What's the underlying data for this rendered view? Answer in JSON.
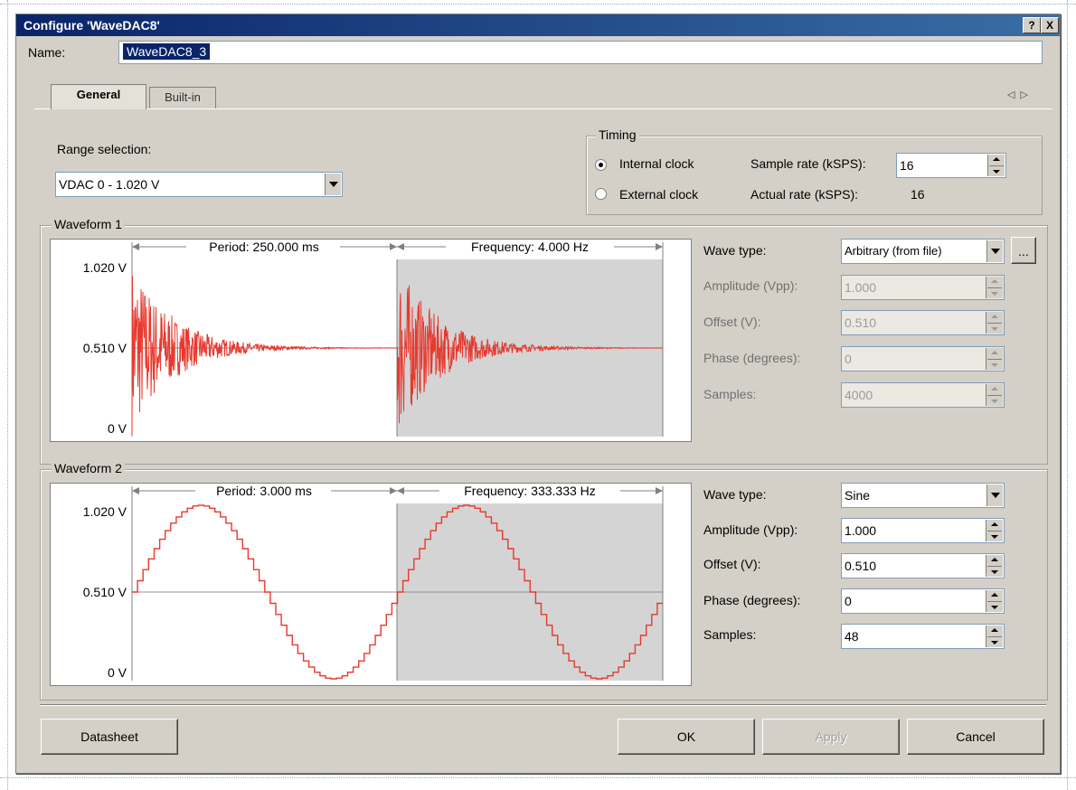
{
  "window": {
    "title": "Configure 'WaveDAC8'",
    "help_btn": "?",
    "close_btn": "X"
  },
  "name": {
    "label": "Name:",
    "value": "WaveDAC8_3"
  },
  "tabs": [
    {
      "label": "General"
    },
    {
      "label": "Built-in"
    }
  ],
  "range": {
    "label": "Range selection:",
    "value": "VDAC 0 - 1.020 V"
  },
  "timing": {
    "title": "Timing",
    "internal_label": "Internal clock",
    "external_label": "External clock",
    "internal_selected": true,
    "sample_rate_label": "Sample rate (kSPS):",
    "sample_rate_value": "16",
    "actual_rate_label": "Actual rate (kSPS):",
    "actual_rate_value": "16"
  },
  "waveform1": {
    "title": "Waveform 1",
    "period_label": "Period: 250.000 ms",
    "frequency_label": "Frequency: 4.000 Hz",
    "y_ticks": [
      "1.020 V",
      "0.510 V",
      "0 V"
    ],
    "wave_type_label": "Wave type:",
    "wave_type_value": "Arbitrary (from file)",
    "browse_label": "...",
    "amplitude_label": "Amplitude (Vpp):",
    "amplitude_value": "1.000",
    "offset_label": "Offset (V):",
    "offset_value": "0.510",
    "phase_label": "Phase (degrees):",
    "phase_value": "0",
    "samples_label": "Samples:",
    "samples_value": "4000",
    "wave_color": "#e8392f"
  },
  "waveform2": {
    "title": "Waveform 2",
    "period_label": "Period: 3.000 ms",
    "frequency_label": "Frequency: 333.333 Hz",
    "y_ticks": [
      "1.020 V",
      "0.510 V",
      "0 V"
    ],
    "wave_type_label": "Wave type:",
    "wave_type_value": "Sine",
    "amplitude_label": "Amplitude (Vpp):",
    "amplitude_value": "1.000",
    "offset_label": "Offset (V):",
    "offset_value": "0.510",
    "phase_label": "Phase (degrees):",
    "phase_value": "0",
    "samples_label": "Samples:",
    "samples_value": "48",
    "wave_color": "#e8392f"
  },
  "buttons": {
    "datasheet": "Datasheet",
    "ok": "OK",
    "apply": "Apply",
    "cancel": "Cancel"
  }
}
